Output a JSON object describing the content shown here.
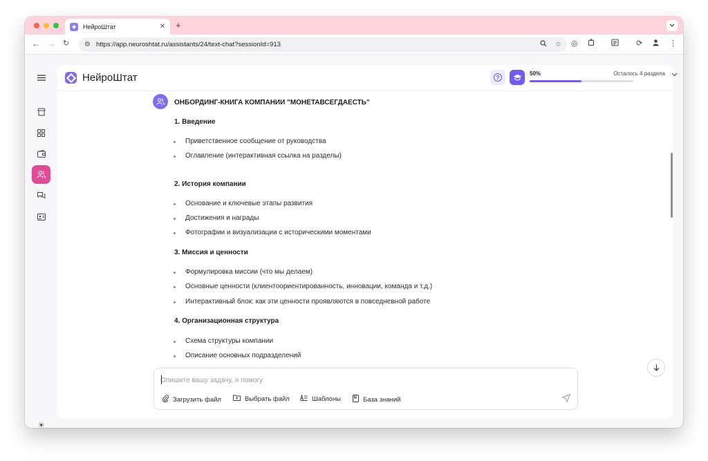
{
  "browser": {
    "tab_title": "НейроШтат",
    "tab_close": "✕",
    "new_tab": "+",
    "url": "https://app.neuroshtat.ru/assistants/24/text-chat?sessionId=913"
  },
  "app": {
    "brand": "НейроШтат",
    "help_glyph": "?",
    "progress": {
      "percent_label": "50%",
      "percent_value": 50,
      "remaining_label": "Осталось 4 раздела"
    }
  },
  "document": {
    "title": "ОНБОРДИНГ-КНИГА КОМПАНИИ \"МОНЕТАВСЕГДАЕСТЬ\"",
    "sections": [
      {
        "heading": "1. Введение",
        "items": [
          "Приветственное сообщение от руководства",
          "Оглавление (интерактивная ссылка на разделы)"
        ]
      },
      {
        "heading": "2. История компании",
        "items": [
          "Основание и ключевые этапы развития",
          "Достижения и награды",
          "Фотографии и визуализации с историческими моментами"
        ]
      },
      {
        "heading": "3. Миссия и ценности",
        "items": [
          "Формулировка миссии (что мы делаем)",
          "Основные ценности (клиентоориентированность, инновации, команда и т.д.)",
          "Интерактивный блок: как эти ценности проявляются в повседневной работе"
        ]
      },
      {
        "heading": "4. Организационная структура",
        "items": [
          "Схема структуры компании",
          "Описание основных подразделений"
        ]
      }
    ]
  },
  "composer": {
    "placeholder": "Опишите вашу задачу, я помогу",
    "actions": {
      "upload": "Загрузить файл",
      "choose": "Выбрать файл",
      "templates": "Шаблоны",
      "knowledge": "База знаний"
    }
  },
  "icons": {
    "sidebar": [
      "store-icon",
      "grid-icon",
      "wallet-icon",
      "users-icon",
      "chat-icon",
      "id-card-icon"
    ],
    "theme": "sun-icon"
  },
  "colors": {
    "tab_strip": "#ffd3dc",
    "accent": "#6f5cf0",
    "active_nav": "#e04b97"
  }
}
